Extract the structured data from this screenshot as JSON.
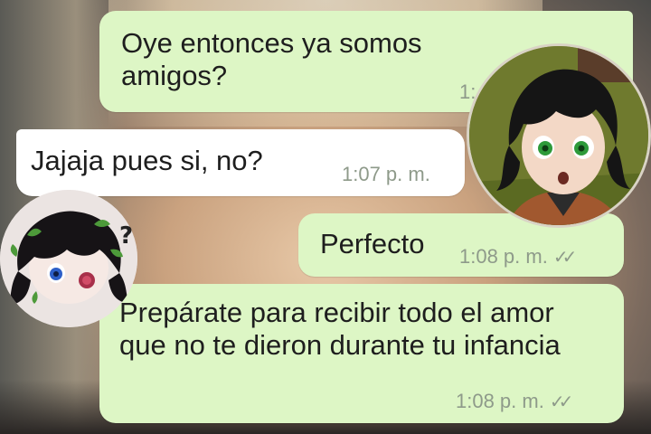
{
  "messages": [
    {
      "side": "outgoing",
      "text": "Oye entonces ya somos amigos?",
      "time": "1:",
      "ticks": ""
    },
    {
      "side": "incoming",
      "text": "Jajaja pues si, no?",
      "time": "1:07 p. m.",
      "ticks": ""
    },
    {
      "side": "outgoing",
      "text": "Perfecto",
      "time": "1:08 p. m.",
      "ticks": "✓✓"
    },
    {
      "side": "outgoing",
      "text": "Prepárate para recibir todo el amor que no te dieron durante tu infancia",
      "time": "1:08 p. m.",
      "ticks": "✓✓"
    }
  ],
  "overlay": {
    "question_mark": "?"
  },
  "colors": {
    "outgoing_bubble": "#ddf6c5",
    "incoming_bubble": "#ffffff",
    "meta_text": "#8e9a8a"
  }
}
